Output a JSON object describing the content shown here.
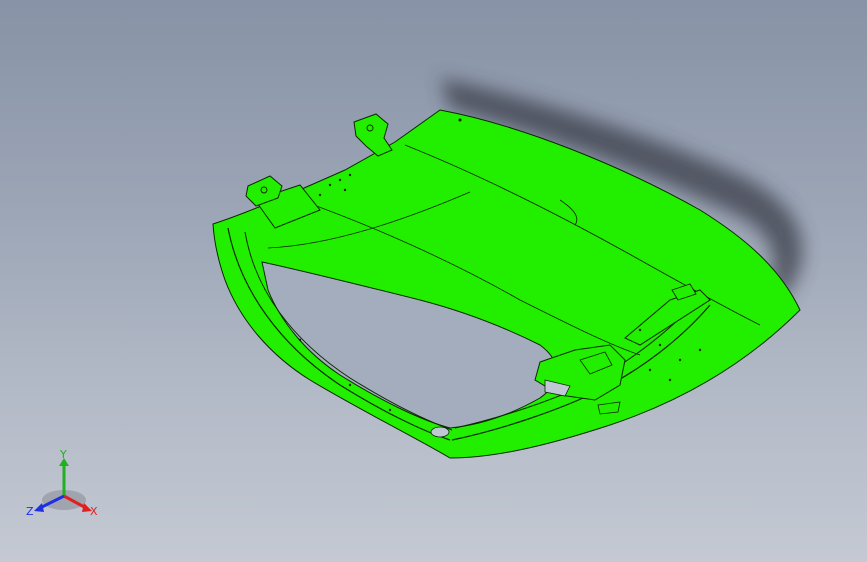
{
  "viewport": {
    "background_top": "#8793a6",
    "background_bottom": "#c4c9d3"
  },
  "model": {
    "part_color": "#22ee00",
    "edge_color": "#0a2a00",
    "shadow_color": "#3a3e48"
  },
  "triad": {
    "x_label": "X",
    "y_label": "Y",
    "z_label": "Z",
    "x_color": "#e02020",
    "y_color": "#20b020",
    "z_color": "#2030e0"
  }
}
